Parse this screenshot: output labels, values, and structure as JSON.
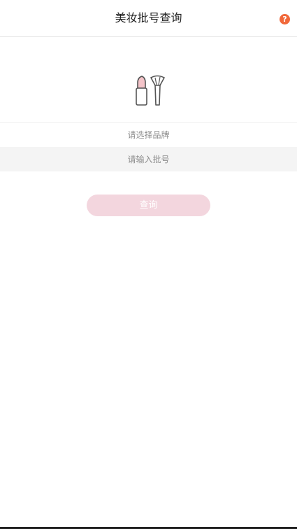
{
  "header": {
    "title": "美妆批号查询",
    "help_label": "?"
  },
  "hero": {
    "icon": "lipstick-brush-icon"
  },
  "form": {
    "brand_placeholder": "请选择品牌",
    "batch_placeholder": "请输入批号",
    "batch_value": "",
    "query_label": "查询"
  },
  "colors": {
    "accent": "#f1683a",
    "button": "#f3d6de",
    "lipstick": "#f4c4c9",
    "field_bg": "#f4f4f4"
  }
}
